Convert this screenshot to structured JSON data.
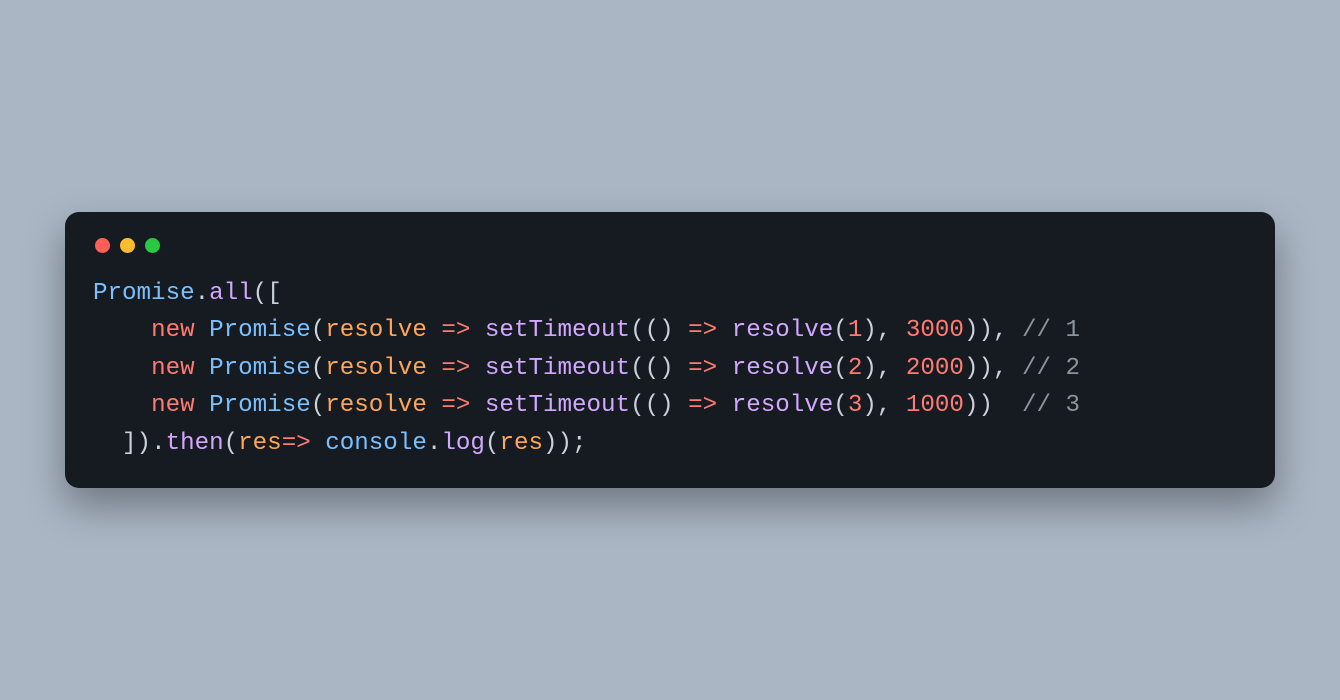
{
  "titlebar": {
    "red": "red",
    "yellow": "yellow",
    "green": "green"
  },
  "code": {
    "Promise": "Promise",
    "dot": ".",
    "all": "all",
    "op": "(",
    "cp": ")",
    "ob": "[",
    "cb": "]",
    "new": "new",
    "resolve_param": "resolve",
    "arrow": "=>",
    "setTimeout": "setTimeout",
    "empty_parens": "()",
    "resolve_call": "resolve",
    "n1": "1",
    "n2": "2",
    "n3": "3",
    "d3000": "3000",
    "d2000": "2000",
    "d1000": "1000",
    "comma": ",",
    "semicolon": ";",
    "c1": "// 1",
    "c2": "// 2",
    "c3": "// 3",
    "then": "then",
    "res": "res",
    "console": "console",
    "log": "log",
    "sp": " ",
    "indent4": "    ",
    "indent2": "  "
  }
}
